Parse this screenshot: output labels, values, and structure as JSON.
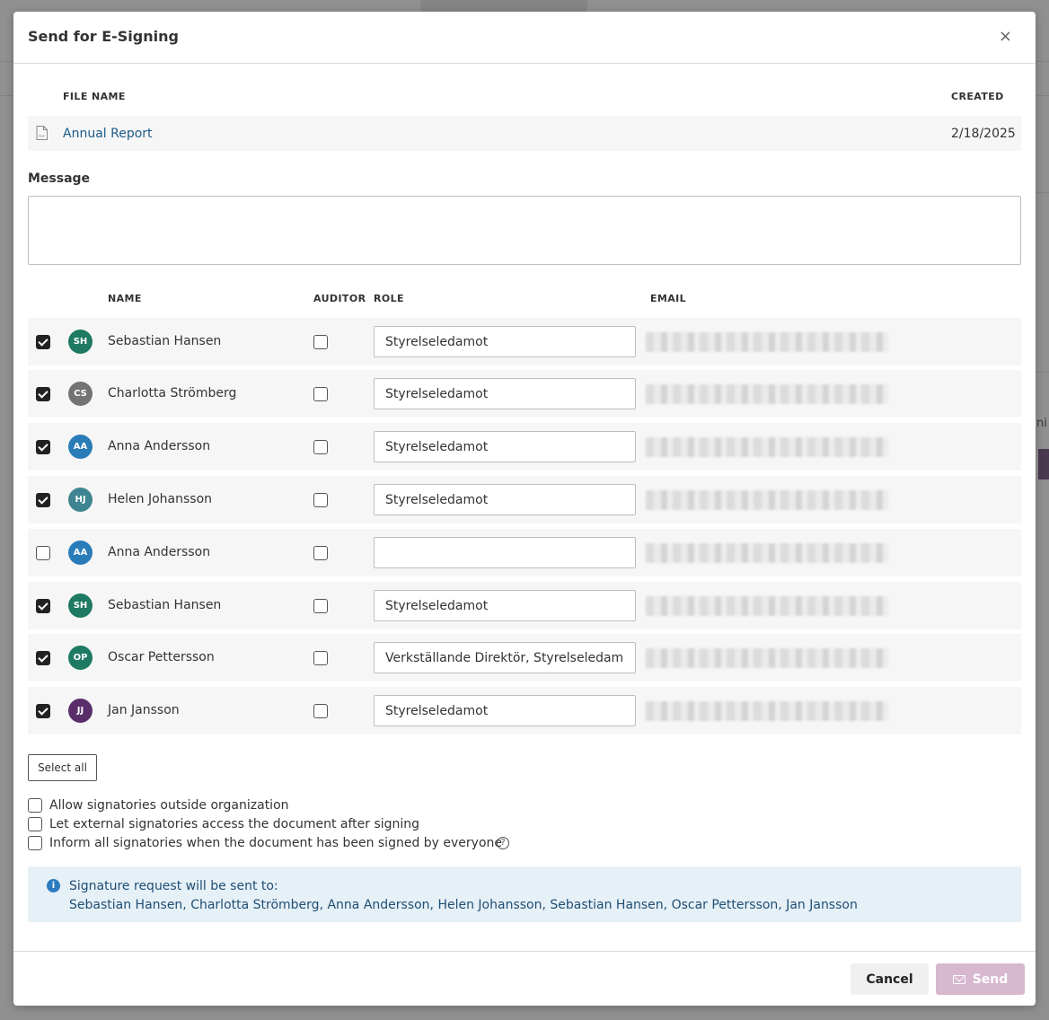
{
  "dialog": {
    "title": "Send for E-Signing",
    "close_glyph": "×"
  },
  "file_table": {
    "headers": {
      "name": "FILE NAME",
      "created": "CREATED"
    },
    "file": {
      "name": "Annual Report",
      "created": "2/18/2025",
      "icon": "pdf-file-icon"
    }
  },
  "message": {
    "label": "Message",
    "value": "",
    "placeholder": ""
  },
  "signers_table": {
    "headers": {
      "name": "NAME",
      "auditor": "AUDITOR",
      "role": "ROLE",
      "email": "EMAIL"
    },
    "rows": [
      {
        "initials": "SH",
        "name": "Sebastian Hansen",
        "selected": true,
        "auditor": false,
        "role": "Styrelseledamot",
        "avatar_color": "#1f7a63"
      },
      {
        "initials": "CS",
        "name": "Charlotta Strömberg",
        "selected": true,
        "auditor": false,
        "role": "Styrelseledamot",
        "avatar_color": "#737373"
      },
      {
        "initials": "AA",
        "name": "Anna Andersson",
        "selected": true,
        "auditor": false,
        "role": "Styrelseledamot",
        "avatar_color": "#2a7cb8"
      },
      {
        "initials": "HJ",
        "name": "Helen Johansson",
        "selected": true,
        "auditor": false,
        "role": "Styrelseledamot",
        "avatar_color": "#3f8591"
      },
      {
        "initials": "AA",
        "name": "Anna Andersson",
        "selected": false,
        "auditor": false,
        "role": "",
        "avatar_color": "#2a7cb8"
      },
      {
        "initials": "SH",
        "name": "Sebastian Hansen",
        "selected": true,
        "auditor": false,
        "role": "Styrelseledamot",
        "avatar_color": "#1f7a63"
      },
      {
        "initials": "OP",
        "name": "Oscar Pettersson",
        "selected": true,
        "auditor": false,
        "role": "Verkställande Direktör, Styrelseledamot",
        "avatar_color": "#1f7a63"
      },
      {
        "initials": "JJ",
        "name": "Jan Jansson",
        "selected": true,
        "auditor": false,
        "role": "Styrelseledamot",
        "avatar_color": "#5a2e6b"
      }
    ]
  },
  "select_all_label": "Select all",
  "options": [
    {
      "label": "Allow signatories outside organization",
      "checked": false
    },
    {
      "label": "Let external signatories access the document after signing",
      "checked": false
    },
    {
      "label": "Inform all signatories when the document has been signed by everyone",
      "checked": false,
      "help_glyph": "?"
    }
  ],
  "info": {
    "icon_glyph": "i",
    "title": "Signature request will be sent to:",
    "names": "Sebastian Hansen, Charlotta Strömberg, Anna Andersson, Helen Johansson, Sebastian Hansen, Oscar Pettersson, Jan Jansson"
  },
  "footer": {
    "cancel_label": "Cancel",
    "send_label": "Send"
  },
  "background": {
    "fragment_text": "ni"
  }
}
